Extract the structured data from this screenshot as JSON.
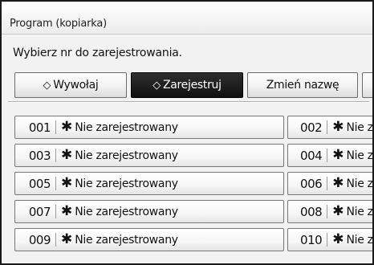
{
  "window": {
    "title": "Program (kopiarka)"
  },
  "instruction": "Wybierz nr do zarejestrowania.",
  "actions": {
    "recall": {
      "icon": "◇",
      "label": "Wywołaj"
    },
    "register": {
      "icon": "◇",
      "label": "Zarejestruj"
    },
    "rename": {
      "label": "Zmień nazwę"
    }
  },
  "programs": [
    {
      "num": "001",
      "icon": "✱",
      "status": "Nie zarejestrowany"
    },
    {
      "num": "002",
      "icon": "✱",
      "status": "Nie za"
    },
    {
      "num": "003",
      "icon": "✱",
      "status": "Nie zarejestrowany"
    },
    {
      "num": "004",
      "icon": "✱",
      "status": "Nie za"
    },
    {
      "num": "005",
      "icon": "✱",
      "status": "Nie zarejestrowany"
    },
    {
      "num": "006",
      "icon": "✱",
      "status": "Nie za"
    },
    {
      "num": "007",
      "icon": "✱",
      "status": "Nie zarejestrowany"
    },
    {
      "num": "008",
      "icon": "✱",
      "status": "Nie za"
    },
    {
      "num": "009",
      "icon": "✱",
      "status": "Nie zarejestrowany"
    },
    {
      "num": "010",
      "icon": "✱",
      "status": "Nie za"
    }
  ],
  "colors": {
    "selected_button": "#151515",
    "panel": "#f2f2f2"
  }
}
